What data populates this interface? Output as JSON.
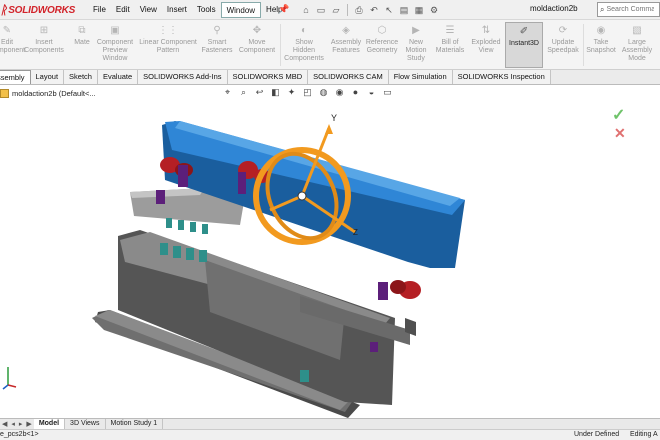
{
  "app": {
    "brand": "SOLIDWORKS",
    "document_title": "moldaction2b",
    "search_placeholder": "Search Comman"
  },
  "menu": [
    "File",
    "Edit",
    "View",
    "Insert",
    "Tools",
    "Window",
    "Help"
  ],
  "active_menu": "Window",
  "toolbar": {
    "edit_component": "Edit\nComponent",
    "insert_components": "Insert\nComponents",
    "mate": "Mate",
    "component_preview": "Component\nPreview\nWindow",
    "linear_pattern": "Linear Component\nPattern",
    "smart_fasteners": "Smart\nFasteners",
    "move_component": "Move\nComponent",
    "show_hidden": "Show\nHidden\nComponents",
    "assembly_features": "Assembly\nFeatures",
    "reference_geometry": "Reference\nGeometry",
    "new_motion_study": "New\nMotion\nStudy",
    "bill_of_materials": "Bill of\nMaterials",
    "exploded_view": "Exploded\nView",
    "instant3d": "Instant3D",
    "update_speedpak": "Update\nSpeedpak",
    "take_snapshot": "Take\nSnapshot",
    "large_assembly": "Large\nAssembly\nMode"
  },
  "tabs": [
    "Assembly",
    "Layout",
    "Sketch",
    "Evaluate",
    "SOLIDWORKS Add-Ins",
    "SOLIDWORKS MBD",
    "SOLIDWORKS CAM",
    "Flow Simulation",
    "SOLIDWORKS Inspection"
  ],
  "tree": {
    "root_label": "moldaction2b  (Default<..."
  },
  "viewport": {
    "axis_y": "Y",
    "axis_z": "Z"
  },
  "bottom_tabs": [
    "Model",
    "3D Views",
    "Motion Study 1"
  ],
  "status": {
    "left": "e_pcs2b<1>",
    "defined": "Under Defined",
    "editing": "Editing A"
  },
  "colors": {
    "top_plate": "#2f86d6",
    "plate_gray": "#7d7d7d",
    "triad_orange": "#f29a1f",
    "bolt_red": "#b51f24",
    "pin_purple": "#5c1f7a",
    "spring_teal": "#2e8f8a"
  }
}
